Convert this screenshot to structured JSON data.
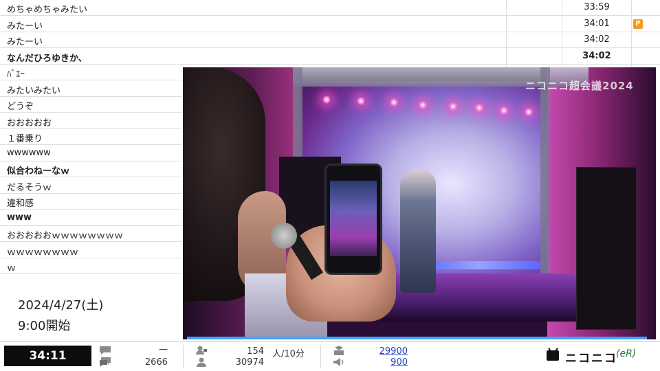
{
  "comments": [
    {
      "text": "めちゃめちゃみたい",
      "time": "33:59",
      "bold": false,
      "premium": false
    },
    {
      "text": "みたーい",
      "time": "34:01",
      "bold": false,
      "premium": true
    },
    {
      "text": "みたーい",
      "time": "34:02",
      "bold": false,
      "premium": false
    },
    {
      "text": "なんだひろゆきか、",
      "time": "34:02",
      "bold": true,
      "premium": false
    },
    {
      "text": "ﾊﾞｴｰ",
      "time": "",
      "bold": false,
      "premium": false
    },
    {
      "text": "みたいみたい",
      "time": "",
      "bold": false,
      "premium": false
    },
    {
      "text": "どうぞ",
      "time": "",
      "bold": false,
      "premium": false
    },
    {
      "text": "おおおおお",
      "time": "",
      "bold": false,
      "premium": false
    },
    {
      "text": "１番乗り",
      "time": "",
      "bold": false,
      "premium": false
    },
    {
      "text": "wwwwww",
      "time": "",
      "bold": false,
      "premium": false
    },
    {
      "text": "似合わねーなｗ",
      "time": "",
      "bold": true,
      "premium": false
    },
    {
      "text": "だるそうｗ",
      "time": "",
      "bold": false,
      "premium": false
    },
    {
      "text": "違和感",
      "time": "",
      "bold": false,
      "premium": false
    },
    {
      "text": "www",
      "time": "",
      "bold": true,
      "premium": false
    },
    {
      "text": "おおおおおｗｗｗｗｗｗｗｗ",
      "time": "",
      "bold": false,
      "premium": false
    },
    {
      "text": "ｗｗｗｗｗｗｗｗ",
      "time": "",
      "bold": false,
      "premium": false
    },
    {
      "text": "ｗ",
      "time": "",
      "bold": false,
      "premium": false
    }
  ],
  "premium_badge": "P",
  "info": {
    "date": "2024/4/27(土)",
    "start": "9:00開始"
  },
  "video": {
    "watermark": "ニコニコ超会議2024",
    "progress": 0.99
  },
  "bottom": {
    "elapsed": "34:11",
    "comment_dash": "—",
    "comment_total": "2666",
    "viewers_rate": "154",
    "viewers_rate_unit": "人/10分",
    "viewers_total": "30974",
    "gift_1": "29900",
    "gift_2": "900",
    "brand": "ニコニコ",
    "brand_sub": "(eR)"
  },
  "colors": {
    "premium": "#f29b1d",
    "link": "#1f3fbf",
    "progress": "#3fa3ff"
  },
  "icons": [
    "comment-icon",
    "comments-icon",
    "viewer-icon",
    "viewers-icon",
    "gift-icon",
    "ad-icon",
    "niconico-tv-icon"
  ]
}
